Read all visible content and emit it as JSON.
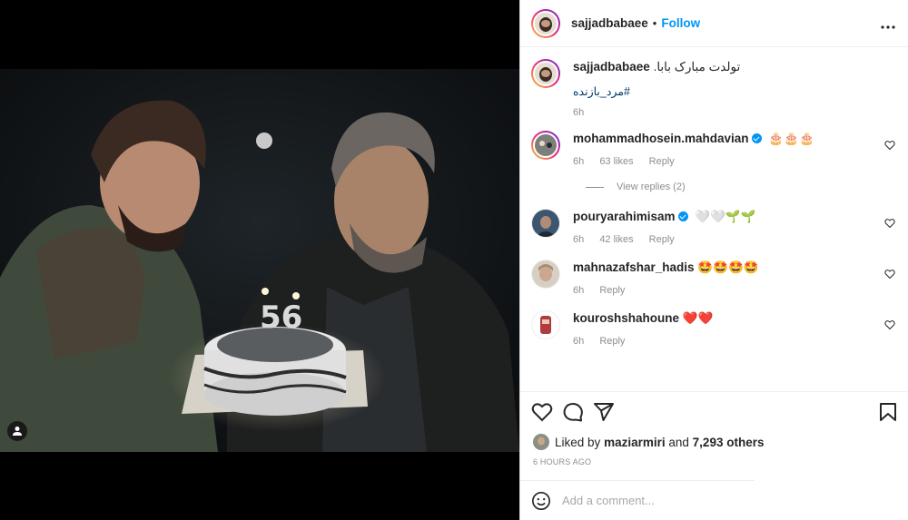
{
  "post": {
    "username": "sajjadbabaee",
    "follow_label": "Follow",
    "separator": "•"
  },
  "caption": {
    "username": "sajjadbabaee",
    "text": "تولدت مبارک بابا.",
    "hashtag": "#مرد_بازنده",
    "time": "6h"
  },
  "comments": [
    {
      "username": "mohammadhosein.mahdavian",
      "verified": true,
      "text": "🎂🎂🎂",
      "time": "6h",
      "likes": "63 likes",
      "reply": "Reply"
    },
    {
      "username": "pouryarahimisam",
      "verified": true,
      "text": "🤍🤍🌱🌱",
      "time": "6h",
      "likes": "42 likes",
      "reply": "Reply"
    },
    {
      "username": "mahnazafshar_hadis",
      "verified": false,
      "text": "🤩🤩🤩🤩",
      "time": "6h",
      "reply": "Reply"
    },
    {
      "username": "kouroshshahoune",
      "verified": false,
      "text": "❤️❤️",
      "time": "6h",
      "reply": "Reply"
    }
  ],
  "view_replies": "View replies (2)",
  "likes": {
    "prefix": "Liked by",
    "user": "maziarmiri",
    "middle": "and",
    "others": "7,293 others"
  },
  "timestamp": "6 HOURS AGO",
  "add_comment": {
    "placeholder": "Add a comment..."
  },
  "colors": {
    "accent": "#0095f6",
    "link": "#00376b",
    "muted": "#8e8e8e"
  },
  "icons": [
    "more-icon",
    "heart-icon",
    "comment-icon",
    "share-icon",
    "bookmark-icon",
    "emoji-icon",
    "user-tag-icon"
  ]
}
